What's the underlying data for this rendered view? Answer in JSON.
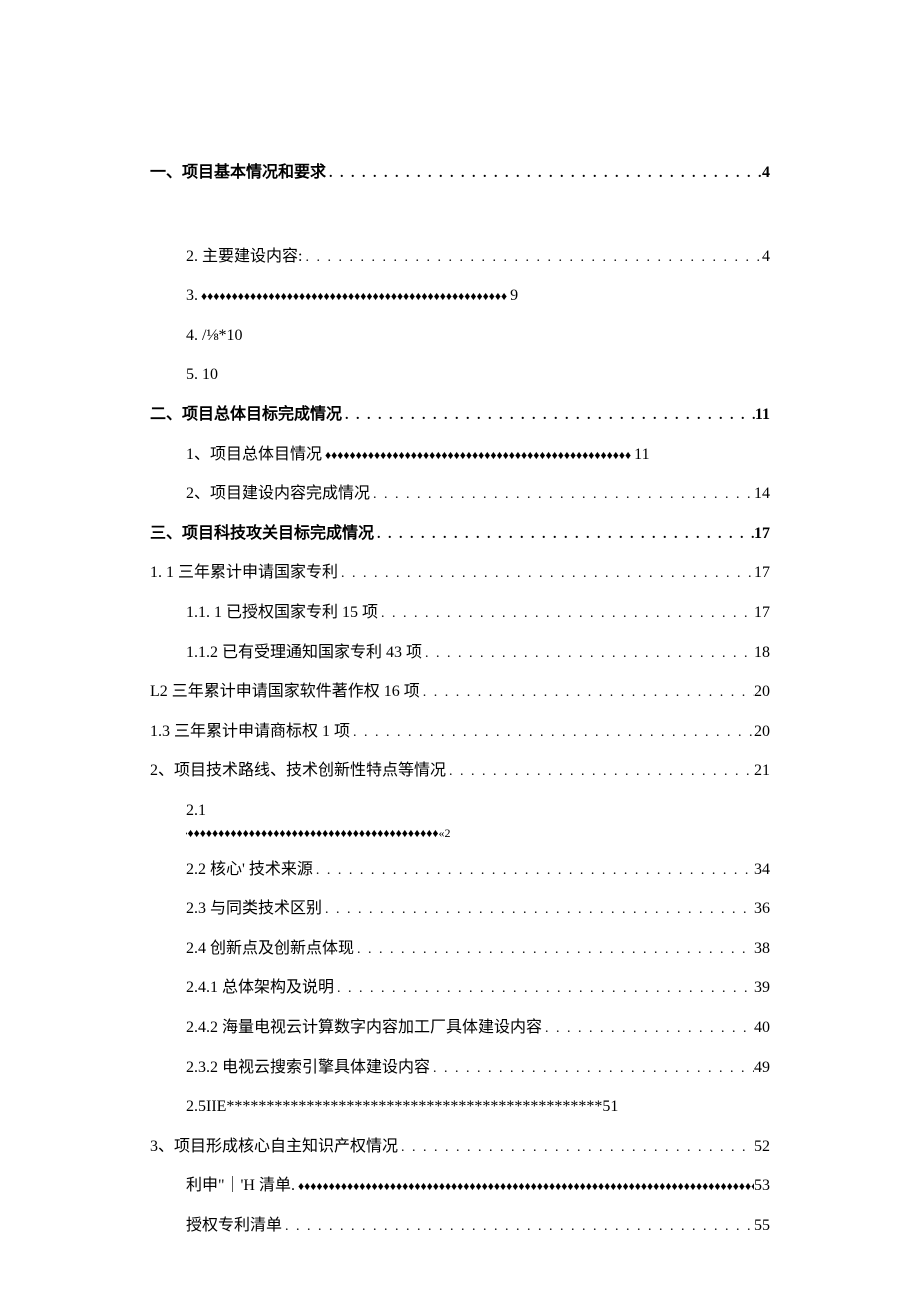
{
  "entries": [
    {
      "id": "e0",
      "indent": "lvl0",
      "text": "一、项目基本情况和要求",
      "leader": "dot",
      "page": "4",
      "bold": true,
      "gap": true
    },
    {
      "id": "e1",
      "indent": "lvl1",
      "text": "2.   主要建设内容:",
      "leader": "dot",
      "page": "4"
    },
    {
      "id": "e2",
      "indent": "lvl1",
      "text": "3.   ",
      "leader": "diamond",
      "page": "9",
      "short": true
    },
    {
      "id": "e3",
      "indent": "lvl1",
      "text": "4.   /⅛*10",
      "leader": "none",
      "page": ""
    },
    {
      "id": "e4",
      "indent": "lvl1",
      "text": "5.   10",
      "leader": "none",
      "page": ""
    },
    {
      "id": "e5",
      "indent": "lvl0",
      "text": "二、项目总体目标完成情况",
      "leader": "dot",
      "page": "11",
      "bold": true
    },
    {
      "id": "e6",
      "indent": "lvl1",
      "text": "1、项目总体目情况",
      "leader": "diamond",
      "page": "11",
      "short": true
    },
    {
      "id": "e7",
      "indent": "lvl1",
      "text": "2、项目建设内容完成情况",
      "leader": "dot",
      "page": "14"
    },
    {
      "id": "e8",
      "indent": "lvl0",
      "text": "三、项目科技攻关目标完成情况",
      "leader": "dot",
      "page": "17",
      "bold": true
    },
    {
      "id": "e9",
      "indent": "l1-num",
      "text": "1.   1 三年累计申请国家专利",
      "leader": "dot",
      "page": "17"
    },
    {
      "id": "e10",
      "indent": "lvl3",
      "text": "1.1.    1 已授权国家专利 15 项",
      "leader": "dot",
      "page": "17"
    },
    {
      "id": "e11",
      "indent": "lvl3",
      "text": "1.1.2 已有受理通知国家专利 43 项",
      "leader": "dot",
      "page": "18"
    },
    {
      "id": "e12",
      "indent": "l1-num",
      "text": "L2 三年累计申请国家软件著作权 16 项",
      "leader": "dot",
      "page": "20"
    },
    {
      "id": "e13",
      "indent": "l1-num",
      "text": "1.3 三年累计申请商标权 1 项",
      "leader": "dot",
      "page": "20"
    },
    {
      "id": "e14",
      "indent": "l1-num",
      "text": "2、项目技术路线、技术创新性特点等情况",
      "leader": "dot",
      "page": "21"
    },
    {
      "id": "wrap",
      "indent": "wrap",
      "num": "2.1",
      "fill": "♦♦♦♦♦♦♦♦♦♦♦♦♦♦♦♦♦♦♦♦♦♦♦♦♦♦♦♦♦♦♦♦♦♦♦♦♦♦♦♦♦♦♦♦♦♦♦♦♦♦♦♦♦«2",
      "hang": "1"
    },
    {
      "id": "e16",
      "indent": "lvl3",
      "text": "2.2 核心' 技术来源",
      "leader": "dot",
      "page": "34"
    },
    {
      "id": "e17",
      "indent": "lvl3",
      "text": "2.3 与同类技术区别",
      "leader": "dot",
      "page": "36"
    },
    {
      "id": "e18",
      "indent": "lvl3",
      "text": "2.4 创新点及创新点体现",
      "leader": "dot",
      "page": "38"
    },
    {
      "id": "e19",
      "indent": "lvl3",
      "text": "2.4.1 总体架构及说明",
      "leader": "dot",
      "page": "39"
    },
    {
      "id": "e20",
      "indent": "lvl3",
      "text": "2.4.2 海量电视云计算数字内容加工厂具体建设内容",
      "leader": "dot",
      "page": "40"
    },
    {
      "id": "e21",
      "indent": "lvl3",
      "text": "2.3.2 电视云搜索引擎具体建设内容",
      "leader": "dot",
      "page": "49"
    },
    {
      "id": "e22",
      "indent": "lvl3",
      "text": "2.5IIE***********************************************51",
      "leader": "none",
      "page": ""
    },
    {
      "id": "e23",
      "indent": "l1-num",
      "text": "3、项目形成核心自主知识产权情况",
      "leader": "dot",
      "page": "52"
    },
    {
      "id": "e24",
      "indent": "lvl3",
      "text": "     利申\"｜'H 清单.",
      "leader": "diamond",
      "page": "53",
      "short": false
    },
    {
      "id": "e25",
      "indent": "lvl3",
      "text": "授权专利清单",
      "leader": "dot",
      "page": "55"
    }
  ],
  "leaders": {
    "dot": ". . . . . . . . . . . . . . . . . . . . . . . . . . . . . . . . . . . . . . . . . . . . . . . . . . . . . . . . . . . . . . . . . . . . . . . . . . . . . . . . . . . . .",
    "diamond_long": "♦♦♦♦♦♦♦♦♦♦♦♦♦♦♦♦♦♦♦♦♦♦♦♦♦♦♦♦♦♦♦♦♦♦♦♦♦♦♦♦♦♦♦♦♦♦♦♦♦♦♦♦♦♦♦♦♦♦♦♦♦♦♦♦♦♦♦♦♦♦♦♦♦♦♦♦♦♦♦♦",
    "diamond_short": "♦♦♦♦♦♦♦♦♦♦♦♦♦♦♦♦♦♦♦♦♦♦♦♦♦♦♦♦♦♦♦♦♦♦♦♦♦♦♦♦♦♦♦♦♦♦♦♦♦♦"
  }
}
